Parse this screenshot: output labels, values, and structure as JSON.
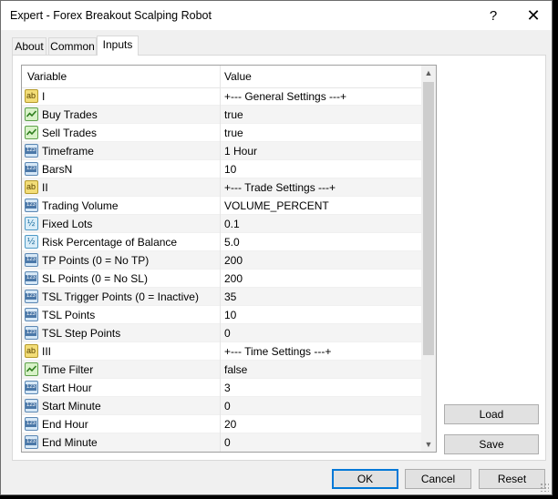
{
  "window": {
    "title": "Expert - Forex Breakout Scalping Robot",
    "help_glyph": "?",
    "close_glyph": "✕"
  },
  "tabs": [
    {
      "label": "About"
    },
    {
      "label": "Common"
    },
    {
      "label": "Inputs",
      "active": true
    }
  ],
  "grid": {
    "headers": {
      "variable": "Variable",
      "value": "Value"
    },
    "rows": [
      {
        "icon": "ab-string-icon",
        "type": "ab",
        "variable": "I",
        "value": "+--- General Settings ---+"
      },
      {
        "icon": "bool-icon",
        "type": "bool",
        "variable": "Buy Trades",
        "value": "true"
      },
      {
        "icon": "bool-icon",
        "type": "bool",
        "variable": "Sell Trades",
        "value": "true"
      },
      {
        "icon": "int-icon",
        "type": "int",
        "variable": "Timeframe",
        "value": "1 Hour"
      },
      {
        "icon": "int-icon",
        "type": "int",
        "variable": "BarsN",
        "value": "10"
      },
      {
        "icon": "ab-string-icon",
        "type": "ab",
        "variable": "II",
        "value": "+--- Trade Settings ---+"
      },
      {
        "icon": "int-icon",
        "type": "int",
        "variable": "Trading Volume",
        "value": "VOLUME_PERCENT"
      },
      {
        "icon": "double-icon",
        "type": "dbl",
        "variable": "Fixed Lots",
        "value": "0.1"
      },
      {
        "icon": "double-icon",
        "type": "dbl",
        "variable": "Risk Percentage of Balance",
        "value": "5.0"
      },
      {
        "icon": "int-icon",
        "type": "int",
        "variable": "TP Points (0 = No TP)",
        "value": "200"
      },
      {
        "icon": "int-icon",
        "type": "int",
        "variable": "SL Points (0 = No SL)",
        "value": "200"
      },
      {
        "icon": "int-icon",
        "type": "int",
        "variable": "TSL Trigger Points (0 = Inactive)",
        "value": "35"
      },
      {
        "icon": "int-icon",
        "type": "int",
        "variable": "TSL Points",
        "value": "10"
      },
      {
        "icon": "int-icon",
        "type": "int",
        "variable": "TSL Step Points",
        "value": "0"
      },
      {
        "icon": "ab-string-icon",
        "type": "ab",
        "variable": "III",
        "value": "+--- Time Settings ---+"
      },
      {
        "icon": "bool-icon",
        "type": "bool",
        "variable": "Time Filter",
        "value": "false"
      },
      {
        "icon": "int-icon",
        "type": "int",
        "variable": "Start Hour",
        "value": "3"
      },
      {
        "icon": "int-icon",
        "type": "int",
        "variable": "Start Minute",
        "value": "0"
      },
      {
        "icon": "int-icon",
        "type": "int",
        "variable": "End Hour",
        "value": "20"
      },
      {
        "icon": "int-icon",
        "type": "int",
        "variable": "End Minute",
        "value": "0"
      }
    ]
  },
  "side_buttons": {
    "load": "Load",
    "save": "Save"
  },
  "dialog_buttons": {
    "ok": "OK",
    "cancel": "Cancel",
    "reset": "Reset"
  },
  "colors": {
    "ok_focus_border": "#0078d7",
    "alt_row": "#f4f4f4"
  }
}
